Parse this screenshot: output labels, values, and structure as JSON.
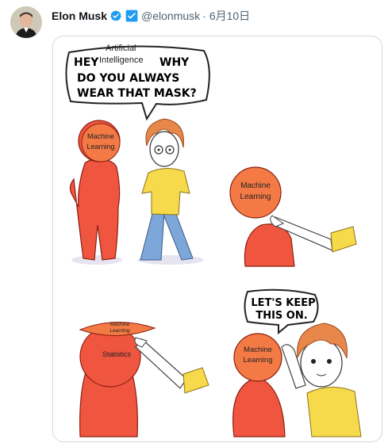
{
  "post": {
    "author_name": "Elon Musk",
    "verified_icon": "verified-badge-icon",
    "account_icon": "twitter-blue-square-icon",
    "handle": "@elonmusk",
    "separator": "·",
    "date": "6月10日"
  },
  "meme": {
    "panel1": {
      "speech_part1": "HEY",
      "speech_label1": "Artificial",
      "speech_label2": "Intelligence",
      "speech_part2": "WHY",
      "speech_line2": "DO YOU ALWAYS",
      "speech_line3": "WEAR THAT MASK?",
      "mask_line1": "Machine",
      "mask_line2": "Learning"
    },
    "panel2": {
      "mask_line1": "Machine",
      "mask_line2": "Learning"
    },
    "panel3": {
      "mask_line1": "Machine",
      "mask_line2": "Learning",
      "head_label": "Statistics"
    },
    "panel4": {
      "speech_line1": "LET'S KEEP",
      "speech_line2": "THIS ON.",
      "mask_line1": "Machine",
      "mask_line2": "Learning"
    }
  },
  "colors": {
    "red_character": "#f0553f",
    "orange_mask": "#f07a3c",
    "yellow_shirt": "#f7d94c",
    "blue_pants": "#7ca7d8",
    "skin": "#ffffff",
    "hair": "#e8874a"
  }
}
